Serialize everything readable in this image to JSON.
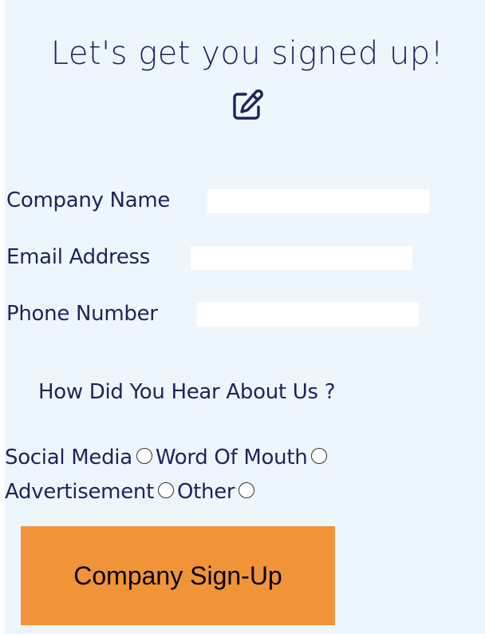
{
  "header": {
    "title": "Let's get you signed up!",
    "icon": "edit-icon"
  },
  "form": {
    "fields": [
      {
        "label": "Company Name",
        "value": "",
        "placeholder": ""
      },
      {
        "label": "Email Address",
        "value": "",
        "placeholder": ""
      },
      {
        "label": "Phone Number",
        "value": "",
        "placeholder": ""
      }
    ],
    "question": "How Did You Hear About Us ?",
    "options": [
      "Social Media",
      "Word Of Mouth",
      "Advertisement",
      "Other"
    ],
    "submit_label": "Company Sign-Up"
  },
  "colors": {
    "background": "#eef6fd",
    "text": "#1f2459",
    "button": "#f09437"
  }
}
